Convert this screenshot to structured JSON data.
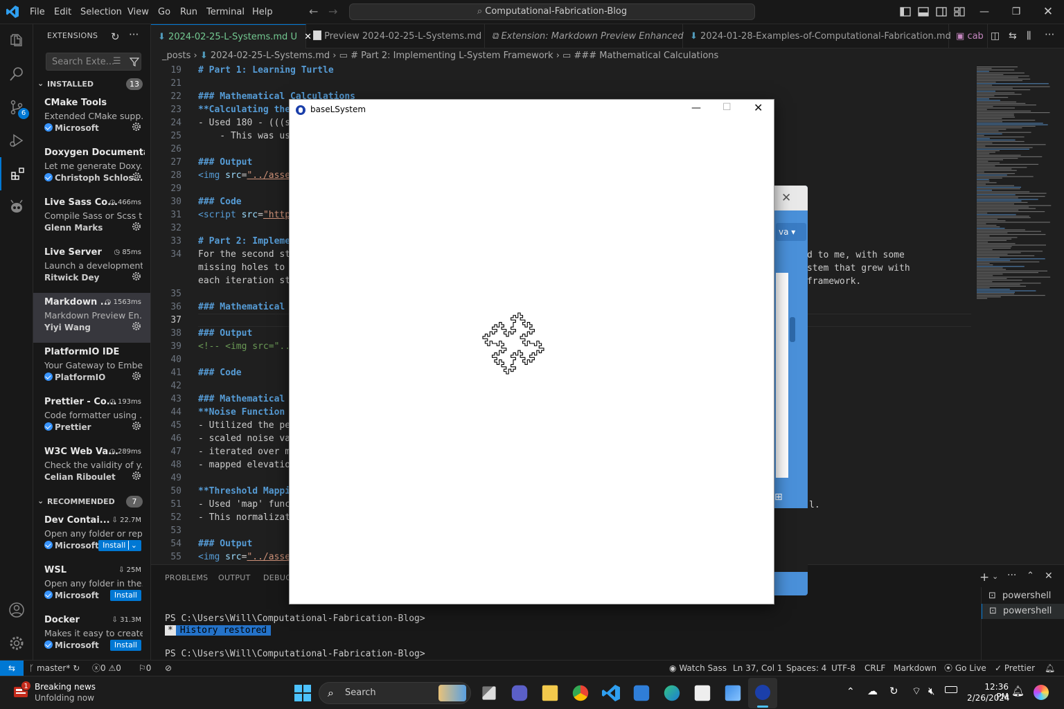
{
  "menu": [
    "File",
    "Edit",
    "Selection",
    "View",
    "Go",
    "Run",
    "Terminal",
    "Help"
  ],
  "command_center": "Computational-Fabrication-Blog",
  "sidebar": {
    "title": "EXTENSIONS",
    "search_placeholder": "Search Exte...",
    "installed_label": "INSTALLED",
    "installed_count": "13",
    "recommended_label": "RECOMMENDED",
    "recommended_count": "7",
    "installed": [
      {
        "name": "CMake Tools",
        "stat": "",
        "desc": "Extended CMake supp...",
        "publisher": "Microsoft",
        "verified": true
      },
      {
        "name": "Doxygen Documenta...",
        "stat": "",
        "desc": "Let me generate Doxy...",
        "publisher": "Christoph Schlos...",
        "verified": true
      },
      {
        "name": "Live Sass Co...",
        "stat": "466ms",
        "desc": "Compile Sass or Scss t...",
        "publisher": "Glenn Marks",
        "verified": false
      },
      {
        "name": "Live Server",
        "stat": "85ms",
        "desc": "Launch a development...",
        "publisher": "Ritwick Dey",
        "verified": false
      },
      {
        "name": "Markdown ...",
        "stat": "1563ms",
        "desc": "Markdown Preview En...",
        "publisher": "Yiyi Wang",
        "verified": false
      },
      {
        "name": "PlatformIO IDE",
        "stat": "",
        "desc": "Your Gateway to Embe...",
        "publisher": "PlatformIO",
        "verified": true
      },
      {
        "name": "Prettier - Co...",
        "stat": "193ms",
        "desc": "Code formatter using ...",
        "publisher": "Prettier",
        "verified": true
      },
      {
        "name": "W3C Web Va...",
        "stat": "289ms",
        "desc": "Check the validity of y...",
        "publisher": "Celian Riboulet",
        "verified": false
      }
    ],
    "recommended": [
      {
        "name": "Dev Contai...",
        "stat": "22.7M",
        "desc": "Open any folder or rep...",
        "publisher": "Microsoft",
        "verified": true,
        "button": "Install"
      },
      {
        "name": "WSL",
        "stat": "25M",
        "desc": "Open any folder in the...",
        "publisher": "Microsoft",
        "verified": true,
        "button": "Install"
      },
      {
        "name": "Docker",
        "stat": "31.3M",
        "desc": "Makes it easy to create...",
        "publisher": "Microsoft",
        "verified": true,
        "button": "Install"
      }
    ]
  },
  "tabs": [
    {
      "label": "2024-02-25-L-Systems.md",
      "suffix": "U"
    },
    {
      "label": "Preview 2024-02-25-L-Systems.md",
      "suffix": ""
    },
    {
      "label": "Extension: Markdown Preview Enhanced",
      "suffix": ""
    },
    {
      "label": "2024-01-28-Examples-of-Computational-Fabrication.md",
      "suffix": ""
    },
    {
      "label": "cab",
      "suffix": ""
    }
  ],
  "breadcrumb": [
    "_posts",
    "2024-02-25-L-Systems.md",
    "# Part 2: Implementing L-System Framework",
    "### Mathematical Calculations"
  ],
  "editor": {
    "lines": [
      {
        "n": "19",
        "t": "# Part 1: Learning Turtle"
      },
      {
        "n": "21",
        "t": ""
      },
      {
        "n": "22",
        "t": "### Mathematical Calculations"
      },
      {
        "n": "23",
        "t": "**Calculating the"
      },
      {
        "n": "24",
        "t": "- Used 180 - (((s"
      },
      {
        "n": "25",
        "t": "    - This was us"
      },
      {
        "n": "26",
        "t": ""
      },
      {
        "n": "27",
        "t": "### Output"
      },
      {
        "n": "28",
        "t": "<img src=\"../asse"
      },
      {
        "n": "29",
        "t": ""
      },
      {
        "n": "30",
        "t": "### Code"
      },
      {
        "n": "31",
        "t": "<script src=\"http"
      },
      {
        "n": "32",
        "t": ""
      },
      {
        "n": "33",
        "t": "# Part 2: Impleme"
      },
      {
        "n": "34",
        "t": "For the second st"
      },
      {
        "n": "",
        "t": "missing holes to"
      },
      {
        "n": "",
        "t": "each iteration st"
      },
      {
        "n": "35",
        "t": ""
      },
      {
        "n": "36",
        "t": "### Mathematical"
      },
      {
        "n": "37",
        "t": ""
      },
      {
        "n": "38",
        "t": "### Output"
      },
      {
        "n": "39",
        "t": "<!-- <img src=\".."
      },
      {
        "n": "40",
        "t": ""
      },
      {
        "n": "41",
        "t": "### Code"
      },
      {
        "n": "42",
        "t": ""
      },
      {
        "n": "43",
        "t": "### Mathematical"
      },
      {
        "n": "44",
        "t": "**Noise Function"
      },
      {
        "n": "45",
        "t": "- Utilized the pe"
      },
      {
        "n": "46",
        "t": "- scaled noise va"
      },
      {
        "n": "47",
        "t": "- iterated over m"
      },
      {
        "n": "48",
        "t": "- mapped elevatio"
      },
      {
        "n": "49",
        "t": ""
      },
      {
        "n": "50",
        "t": "**Threshold Mappi"
      },
      {
        "n": "51",
        "t": "- Used 'map' func"
      },
      {
        "n": "52",
        "t": "- This normalizat"
      },
      {
        "n": "53",
        "t": ""
      },
      {
        "n": "54",
        "t": "### Output"
      },
      {
        "n": "55",
        "t": "<img src=\"../asse"
      }
    ],
    "right_fragments": [
      "rovided to me, with some",
      "l L-System that grew with",
      "g the framework.",
      "l."
    ]
  },
  "panel": {
    "tabs": [
      "PROBLEMS",
      "OUTPUT",
      "DEBUG"
    ],
    "prompt1": "PS C:\\Users\\Will\\Computational-Fabrication-Blog>",
    "history_star": "*",
    "history": "History restored",
    "prompt2": "PS C:\\Users\\Will\\Computational-Fabrication-Blog>",
    "terminals": [
      "powershell",
      "powershell"
    ]
  },
  "status": {
    "branch": "master*",
    "errors": "0",
    "warnings": "0",
    "ports": "0",
    "watch_sass": "Watch Sass",
    "position": "Ln 37, Col 1",
    "spaces": "Spaces: 4",
    "encoding": "UTF-8",
    "eol": "CRLF",
    "language": "Markdown",
    "go_live": "Go Live",
    "prettier": "Prettier"
  },
  "sketch_window": {
    "title": "baseLSystem",
    "win2_dropdown": "va ▾"
  },
  "taskbar": {
    "news_badge": "1",
    "news_title": "Breaking news",
    "news_sub": "Unfolding now",
    "search": "Search",
    "time": "12:36 PM",
    "date": "2/26/2024"
  },
  "colors": {
    "accent": "#0078d4",
    "heading": "#569cd6",
    "string": "#ce9178"
  }
}
